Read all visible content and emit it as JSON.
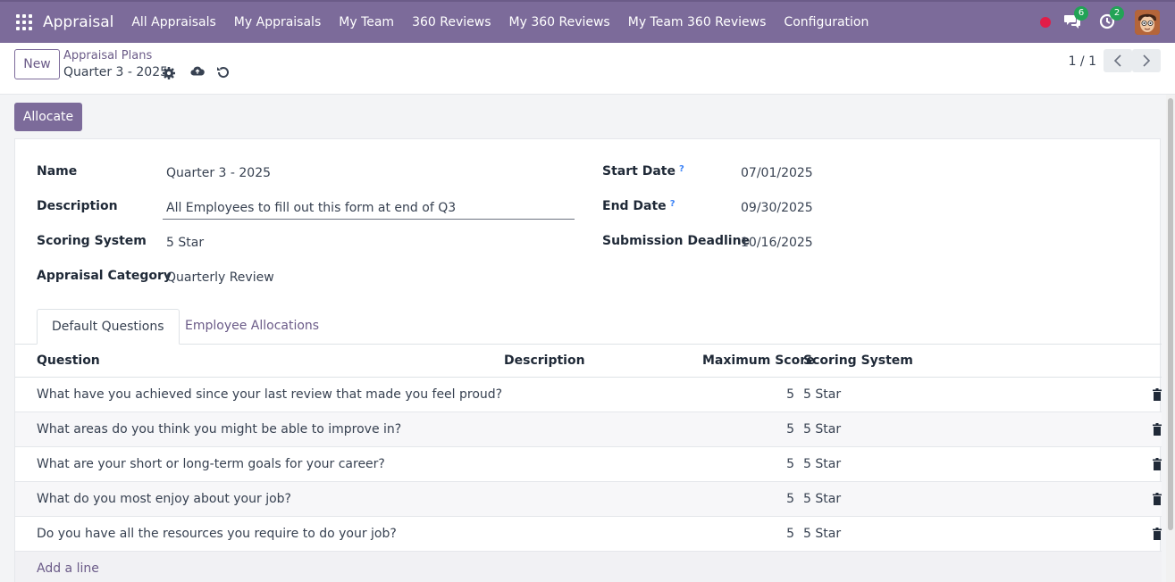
{
  "app": {
    "name": "Appraisal",
    "menu": [
      "All Appraisals",
      "My Appraisals",
      "My Team",
      "360 Reviews",
      "My 360 Reviews",
      "My Team 360 Reviews",
      "Configuration"
    ],
    "messages_count": "6",
    "activities_count": "2"
  },
  "control": {
    "new_label": "New",
    "breadcrumb": "Appraisal Plans",
    "record_title": "Quarter 3 - 2025",
    "pager": "1 / 1"
  },
  "actions": {
    "allocate_label": "Allocate"
  },
  "form": {
    "name_label": "Name",
    "name_value": "Quarter 3 - 2025",
    "description_label": "Description",
    "description_value": "All Employees to fill out this form at end of Q3",
    "scoring_label": "Scoring System",
    "scoring_value": "5 Star",
    "category_label": "Appraisal Category",
    "category_value": "Quarterly Review",
    "start_label": "Start Date",
    "start_value": "07/01/2025",
    "end_label": "End Date",
    "end_value": "09/30/2025",
    "deadline_label": "Submission Deadline",
    "deadline_value": "10/16/2025",
    "help_mark": "?"
  },
  "tabs": [
    "Default Questions",
    "Employee Allocations"
  ],
  "table": {
    "headers": [
      "Question",
      "Description",
      "Maximum Score",
      "Scoring System"
    ],
    "rows": [
      {
        "question": "What have you achieved since your last review that made you feel proud?",
        "score": "5",
        "system": "5 Star"
      },
      {
        "question": "What areas do you think you might be able to improve in?",
        "score": "5",
        "system": "5 Star"
      },
      {
        "question": "What are your short or long-term goals for your career?",
        "score": "5",
        "system": "5 Star"
      },
      {
        "question": "What do you most enjoy about your job?",
        "score": "5",
        "system": "5 Star"
      },
      {
        "question": "Do you have all the resources you require to do your job?",
        "score": "5",
        "system": "5 Star"
      }
    ],
    "add_line": "Add a line"
  },
  "colors": {
    "brand": "#7c6b9a",
    "badge": "#22a356",
    "record_dot": "#e11d48"
  }
}
